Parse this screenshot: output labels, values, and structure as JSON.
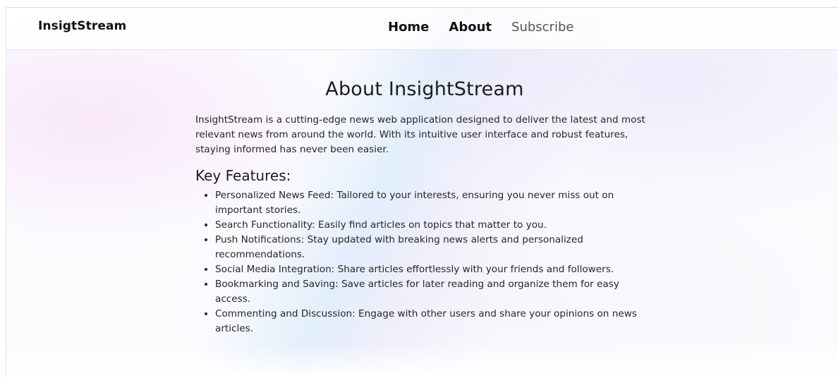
{
  "navbar": {
    "brand": "InsigtStream",
    "links": [
      {
        "label": "Home"
      },
      {
        "label": "About"
      },
      {
        "label": "Subscribe"
      }
    ]
  },
  "main": {
    "title": "About InsightStream",
    "intro": "InsightStream is a cutting-edge news web application designed to deliver the latest and most relevant news from around the world. With its intuitive user interface and robust features, staying informed has never been easier.",
    "features_heading": "Key Features:",
    "features": [
      "Personalized News Feed: Tailored to your interests, ensuring you never miss out on important stories.",
      "Search Functionality: Easily find articles on topics that matter to you.",
      "Push Notifications: Stay updated with breaking news alerts and personalized recommendations.",
      "Social Media Integration: Share articles effortlessly with your friends and followers.",
      "Bookmarking and Saving: Save articles for later reading and organize them for easy access.",
      "Commenting and Discussion: Engage with other users and share your opinions on news articles."
    ]
  }
}
